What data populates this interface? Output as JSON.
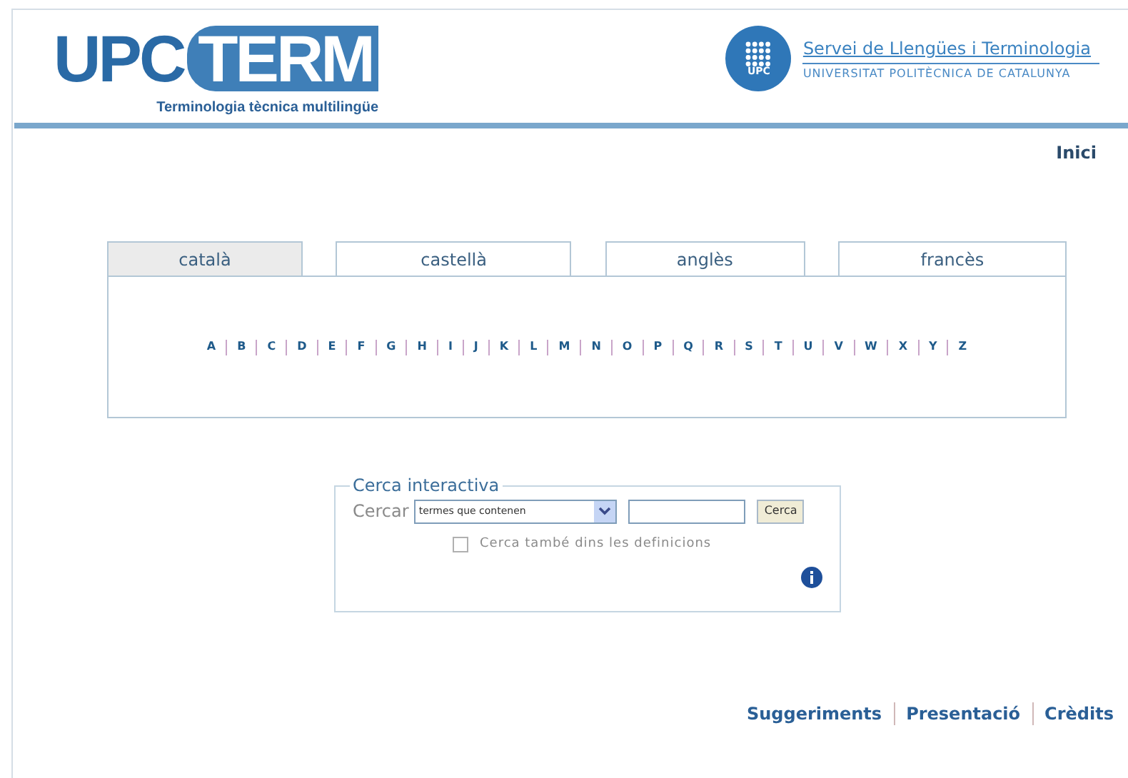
{
  "header": {
    "logo": {
      "part_1": "UPC",
      "part_2": "TERM",
      "subtitle": "Terminologia tècnica multilingüe"
    },
    "org": {
      "emblem": "UPC",
      "name": "Servei de Llengües i Terminologia",
      "university": "UNIVERSITAT POLITÈCNICA DE CATALUNYA"
    }
  },
  "nav": {
    "home": "Inici"
  },
  "tabs": [
    {
      "label": "català",
      "selected": true
    },
    {
      "label": "castellà",
      "selected": false
    },
    {
      "label": "anglès",
      "selected": false
    },
    {
      "label": "francès",
      "selected": false
    }
  ],
  "letters": [
    "A",
    "B",
    "C",
    "D",
    "E",
    "F",
    "G",
    "H",
    "I",
    "J",
    "K",
    "L",
    "M",
    "N",
    "O",
    "P",
    "Q",
    "R",
    "S",
    "T",
    "U",
    "V",
    "W",
    "X",
    "Y",
    "Z"
  ],
  "search": {
    "legend": "Cerca interactiva",
    "label": "Cercar",
    "mode": "termes que contenen",
    "button": "Cerca",
    "option": {
      "label": "Cerca també dins les definicions",
      "checked": false
    }
  },
  "footer": [
    "Suggeriments",
    "Presentació",
    "Crèdits"
  ]
}
